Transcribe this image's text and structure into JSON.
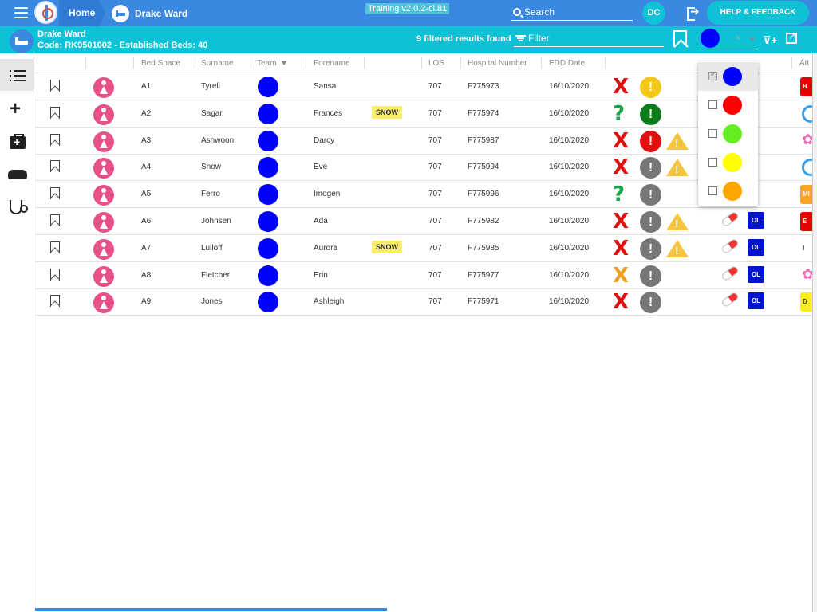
{
  "topbar": {
    "home_label": "Home",
    "ward_label": "Drake Ward",
    "version": "Training v2.0.2-ci.81",
    "search_placeholder": "Search",
    "user_initials": "DC",
    "help_label": "HELP & FEEDBACK"
  },
  "ward": {
    "name": "Drake Ward",
    "code_line": "Code: RK9501002 - Established Beds: 40",
    "results": "9 filtered results found",
    "filter_placeholder": "Filter",
    "selected_team_color": "#0000ff",
    "clear_glyph": "×"
  },
  "columns": {
    "bed_space": "Bed Space",
    "surname": "Surname",
    "team": "Team",
    "forename": "Forename",
    "los": "LOS",
    "hospital_number": "Hospital Number",
    "edd_date": "EDD Date",
    "attention": "Att"
  },
  "rows": [
    {
      "bed": "A1",
      "surname": "Tyrell",
      "team_color": "#0000ff",
      "forename": "Sansa",
      "snow": "",
      "los": "707",
      "hosp": "F775973",
      "edd": "16/10/2020",
      "mark": "X",
      "mark_color": "#e01010",
      "alert_color": "#f2c81b",
      "warn": false,
      "ol": "",
      "att_text": "B",
      "att_bg": "#e60000",
      "att_fg": "#fff",
      "att_kind": "box"
    },
    {
      "bed": "A2",
      "surname": "Sagar",
      "team_color": "#0000ff",
      "forename": "Frances",
      "snow": "SNOW",
      "los": "707",
      "hosp": "F775974",
      "edd": "16/10/2020",
      "mark": "?",
      "mark_color": "#1aa34a",
      "alert_color": "#0d7a1c",
      "warn": false,
      "ol": "",
      "att_text": "",
      "att_bg": "",
      "att_fg": "",
      "att_kind": "ring"
    },
    {
      "bed": "A3",
      "surname": "Ashwoon",
      "team_color": "#0000ff",
      "forename": "Darcy",
      "snow": "",
      "los": "707",
      "hosp": "F775987",
      "edd": "16/10/2020",
      "mark": "X",
      "mark_color": "#e01010",
      "alert_color": "#e01010",
      "warn": true,
      "ol": "",
      "att_text": "",
      "att_bg": "",
      "att_fg": "",
      "att_kind": "flower"
    },
    {
      "bed": "A4",
      "surname": "Snow",
      "team_color": "#0000ff",
      "forename": "Eve",
      "snow": "",
      "los": "707",
      "hosp": "F775994",
      "edd": "16/10/2020",
      "mark": "X",
      "mark_color": "#e01010",
      "alert_color": "#777777",
      "warn": true,
      "ol": "",
      "att_text": "",
      "att_bg": "",
      "att_fg": "",
      "att_kind": "ring"
    },
    {
      "bed": "A5",
      "surname": "Ferro",
      "team_color": "#0000ff",
      "forename": "Imogen",
      "snow": "",
      "los": "707",
      "hosp": "F775996",
      "edd": "16/10/2020",
      "mark": "?",
      "mark_color": "#1aa34a",
      "alert_color": "#777777",
      "warn": false,
      "ol": "",
      "att_text": "MI",
      "att_bg": "#f5a623",
      "att_fg": "#fff",
      "att_kind": "box"
    },
    {
      "bed": "A6",
      "surname": "Johnsen",
      "team_color": "#0000ff",
      "forename": "Ada",
      "snow": "",
      "los": "707",
      "hosp": "F775982",
      "edd": "16/10/2020",
      "mark": "X",
      "mark_color": "#e01010",
      "alert_color": "#777777",
      "warn": true,
      "ol": "OL",
      "att_text": "E",
      "att_bg": "#e60000",
      "att_fg": "#fff",
      "att_kind": "box"
    },
    {
      "bed": "A7",
      "surname": "Lulloff",
      "team_color": "#0000ff",
      "forename": "Aurora",
      "snow": "SNOW",
      "los": "707",
      "hosp": "F775985",
      "edd": "16/10/2020",
      "mark": "X",
      "mark_color": "#e01010",
      "alert_color": "#777777",
      "warn": true,
      "ol": "OL",
      "att_text": "I",
      "att_bg": "#ffffff",
      "att_fg": "#333",
      "att_kind": "box"
    },
    {
      "bed": "A8",
      "surname": "Fletcher",
      "team_color": "#0000ff",
      "forename": "Erin",
      "snow": "",
      "los": "707",
      "hosp": "F775977",
      "edd": "16/10/2020",
      "mark": "X",
      "mark_color": "#f0a020",
      "alert_color": "#777777",
      "warn": false,
      "ol": "OL",
      "att_text": "",
      "att_bg": "",
      "att_fg": "",
      "att_kind": "flower"
    },
    {
      "bed": "A9",
      "surname": "Jones",
      "team_color": "#0000ff",
      "forename": "Ashleigh",
      "snow": "",
      "los": "707",
      "hosp": "F775971",
      "edd": "16/10/2020",
      "mark": "X",
      "mark_color": "#e01010",
      "alert_color": "#777777",
      "warn": false,
      "ol": "OL",
      "att_text": "D",
      "att_bg": "#f8ee1a",
      "att_fg": "#333",
      "att_kind": "box"
    }
  ],
  "team_options": [
    {
      "color": "#0000ff",
      "checked": true
    },
    {
      "color": "#ff0000",
      "checked": false
    },
    {
      "color": "#66ee22",
      "checked": false
    },
    {
      "color": "#ffff00",
      "checked": false
    },
    {
      "color": "#ffa500",
      "checked": false
    }
  ],
  "glyphs": {
    "alert": "!",
    "warn": "!"
  }
}
